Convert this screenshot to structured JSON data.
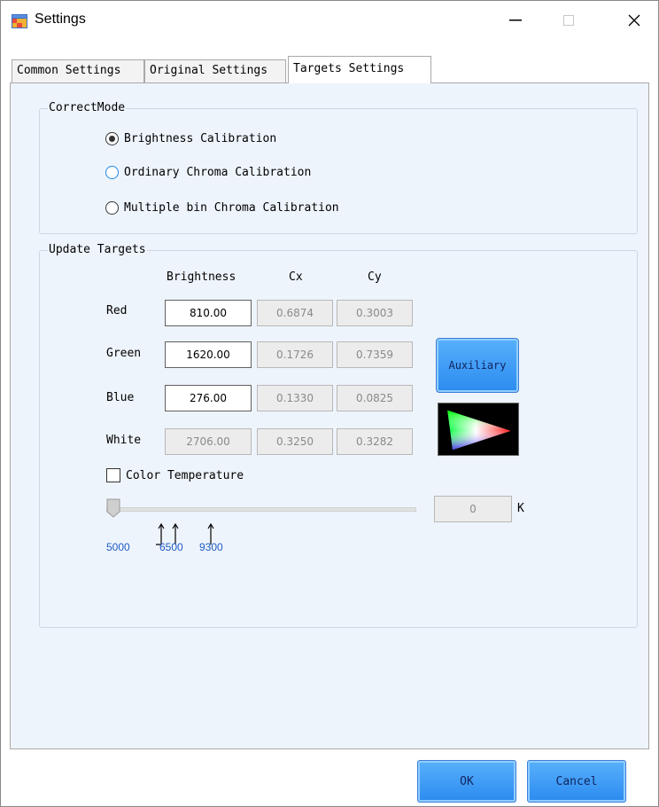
{
  "window": {
    "title": "Settings"
  },
  "tabs": [
    {
      "label": "Common Settings"
    },
    {
      "label": "Original Settings"
    },
    {
      "label": "Targets Settings",
      "active": true
    }
  ],
  "correct_mode": {
    "legend": "CorrectMode",
    "options": [
      {
        "label": "Brightness Calibration",
        "checked": true
      },
      {
        "label": "Ordinary Chroma Calibration",
        "checked": false
      },
      {
        "label": "Multiple bin Chroma Calibration",
        "checked": false
      }
    ]
  },
  "update_targets": {
    "legend": "Update Targets",
    "columns": [
      "Brightness",
      "Cx",
      "Cy"
    ],
    "rows": [
      {
        "label": "Red",
        "brightness": "810.00",
        "cx": "0.6874",
        "cy": "0.3003",
        "editable": true
      },
      {
        "label": "Green",
        "brightness": "1620.00",
        "cx": "0.1726",
        "cy": "0.7359",
        "editable": true
      },
      {
        "label": "Blue",
        "brightness": "276.00",
        "cx": "0.1330",
        "cy": "0.0825",
        "editable": true
      },
      {
        "label": "White",
        "brightness": "2706.00",
        "cx": "0.3250",
        "cy": "0.3282",
        "editable": false
      }
    ],
    "auxiliary_label": "Auxiliary",
    "color_temperature_label": "Color Temperature",
    "color_temperature_checked": false,
    "temperature_value": "0",
    "temperature_unit": "K",
    "markers": [
      "5000",
      "6500",
      "9300"
    ]
  },
  "buttons": {
    "ok": "OK",
    "cancel": "Cancel"
  },
  "colors": {
    "panel_bg": "#eef4fc",
    "button_blue": "#2b8bf0",
    "marker_text": "#1e5bc4"
  }
}
